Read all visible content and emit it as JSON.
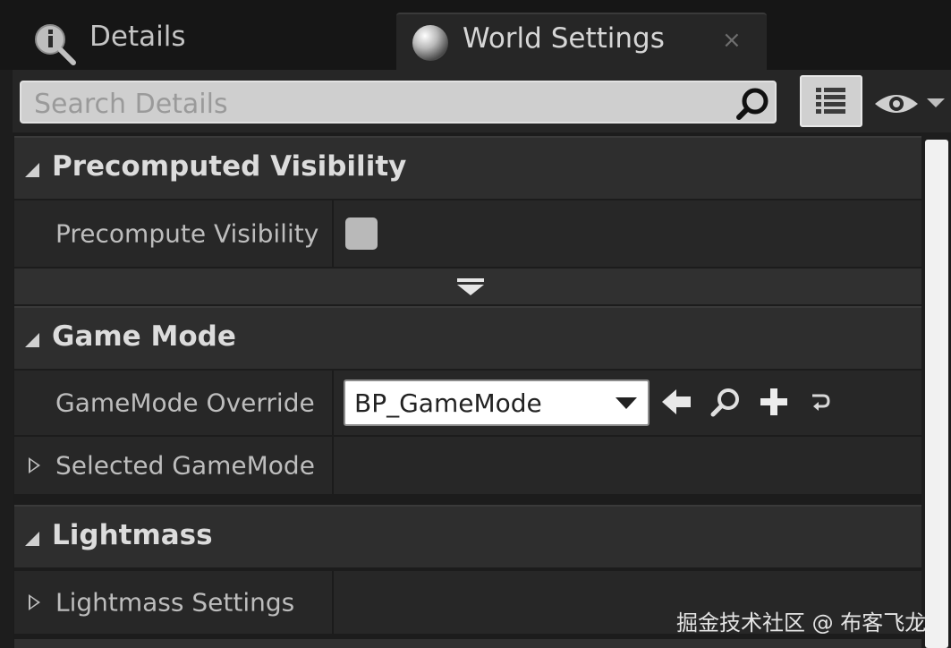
{
  "tabs": {
    "details_label": "Details",
    "world_settings_label": "World Settings",
    "close_glyph": "×"
  },
  "search": {
    "placeholder": "Search Details"
  },
  "icons": {
    "details_tab": "details-info-icon",
    "world_tab": "world-sphere-icon",
    "search": "search-icon",
    "view_options": "list-view-icon",
    "visibility": "eye-icon",
    "browse": "use-selected-arrow-icon",
    "find": "browse-search-icon",
    "add": "plus-icon",
    "reset": "reset-icon"
  },
  "categories": {
    "precomputed_visibility": {
      "title": "Precomputed Visibility",
      "properties": {
        "precompute_visibility": {
          "label": "Precompute Visibility",
          "checked": false
        }
      }
    },
    "game_mode": {
      "title": "Game Mode",
      "properties": {
        "gamemode_override": {
          "label": "GameMode Override",
          "value": "BP_GameMode"
        },
        "selected_gamemode": {
          "label": "Selected GameMode"
        }
      }
    },
    "lightmass": {
      "title": "Lightmass",
      "properties": {
        "lightmass_settings": {
          "label": "Lightmass Settings"
        }
      }
    }
  },
  "watermark": "掘金技术社区 @ 布客飞龙",
  "colors": {
    "background": "#1d1d1d",
    "category_header": "#2e2e2e",
    "property_row": "#272727",
    "text": "#c8c8c8"
  }
}
